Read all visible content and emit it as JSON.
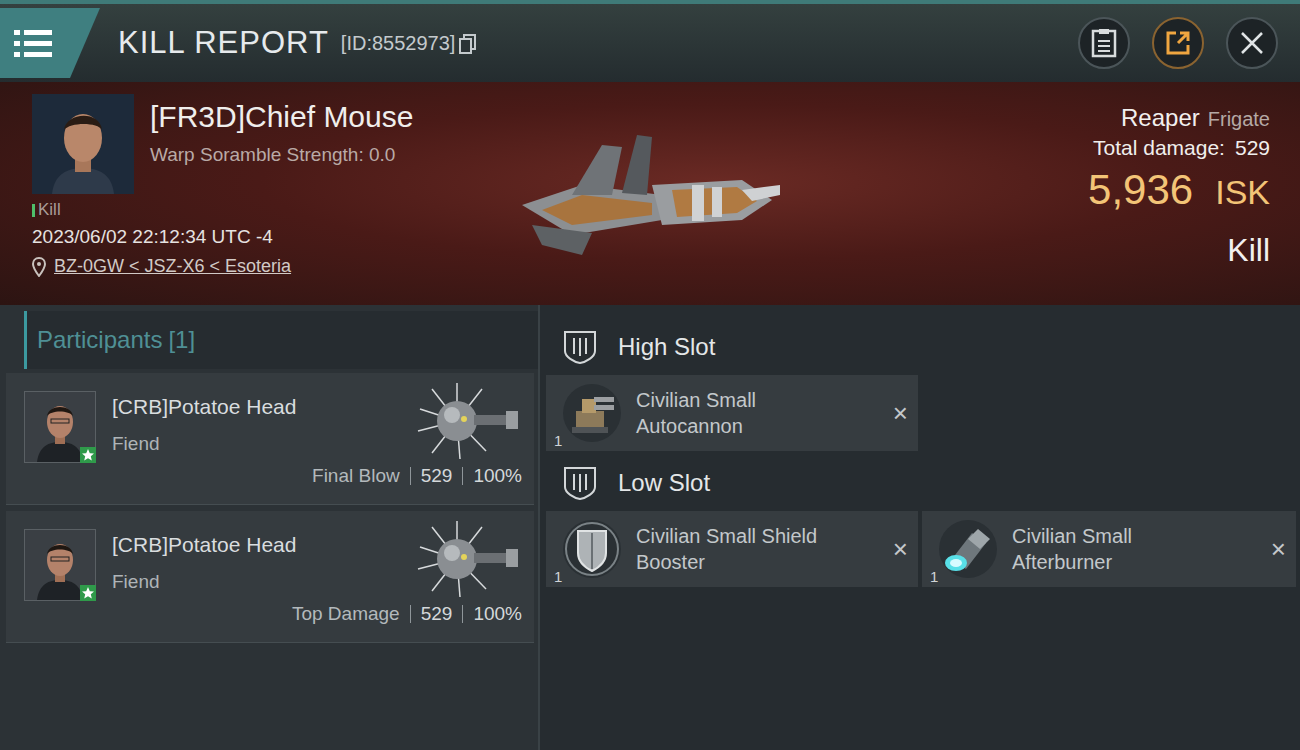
{
  "header": {
    "title": "KILL REPORT",
    "id": "[ID:8552973]"
  },
  "victim": {
    "name": "[FR3D]Chief Mouse",
    "subtitle": "Warp Soramble Strength: 0.0",
    "status": "Kill",
    "timestamp": "2023/06/02 22:12:34 UTC -4",
    "location": "BZ-0GW < JSZ-X6 < Esoteria"
  },
  "ship": {
    "name": "Reaper",
    "class": "Frigate",
    "damage_label": "Total damage:",
    "damage": "529",
    "value": "5,936",
    "currency": "ISK",
    "result": "Kill"
  },
  "participants": {
    "title": "Participants",
    "count": "[1]",
    "items": [
      {
        "name": "[CRB]Potatoe Head",
        "ship": "Fiend",
        "role": "Final Blow",
        "damage": "529",
        "share": "100%"
      },
      {
        "name": "[CRB]Potatoe Head",
        "ship": "Fiend",
        "role": "Top Damage",
        "damage": "529",
        "share": "100%"
      }
    ]
  },
  "slots": [
    {
      "title": "High Slot",
      "modules": [
        {
          "name": "Civilian Small Autocannon",
          "qty": "1",
          "mark": "×",
          "kind": "gun"
        }
      ]
    },
    {
      "title": "Low Slot",
      "modules": [
        {
          "name": "Civilian Small Shield Booster",
          "qty": "1",
          "mark": "×",
          "kind": "shield"
        },
        {
          "name": "Civilian Small Afterburner",
          "qty": "1",
          "mark": "×",
          "kind": "engine"
        }
      ]
    }
  ]
}
